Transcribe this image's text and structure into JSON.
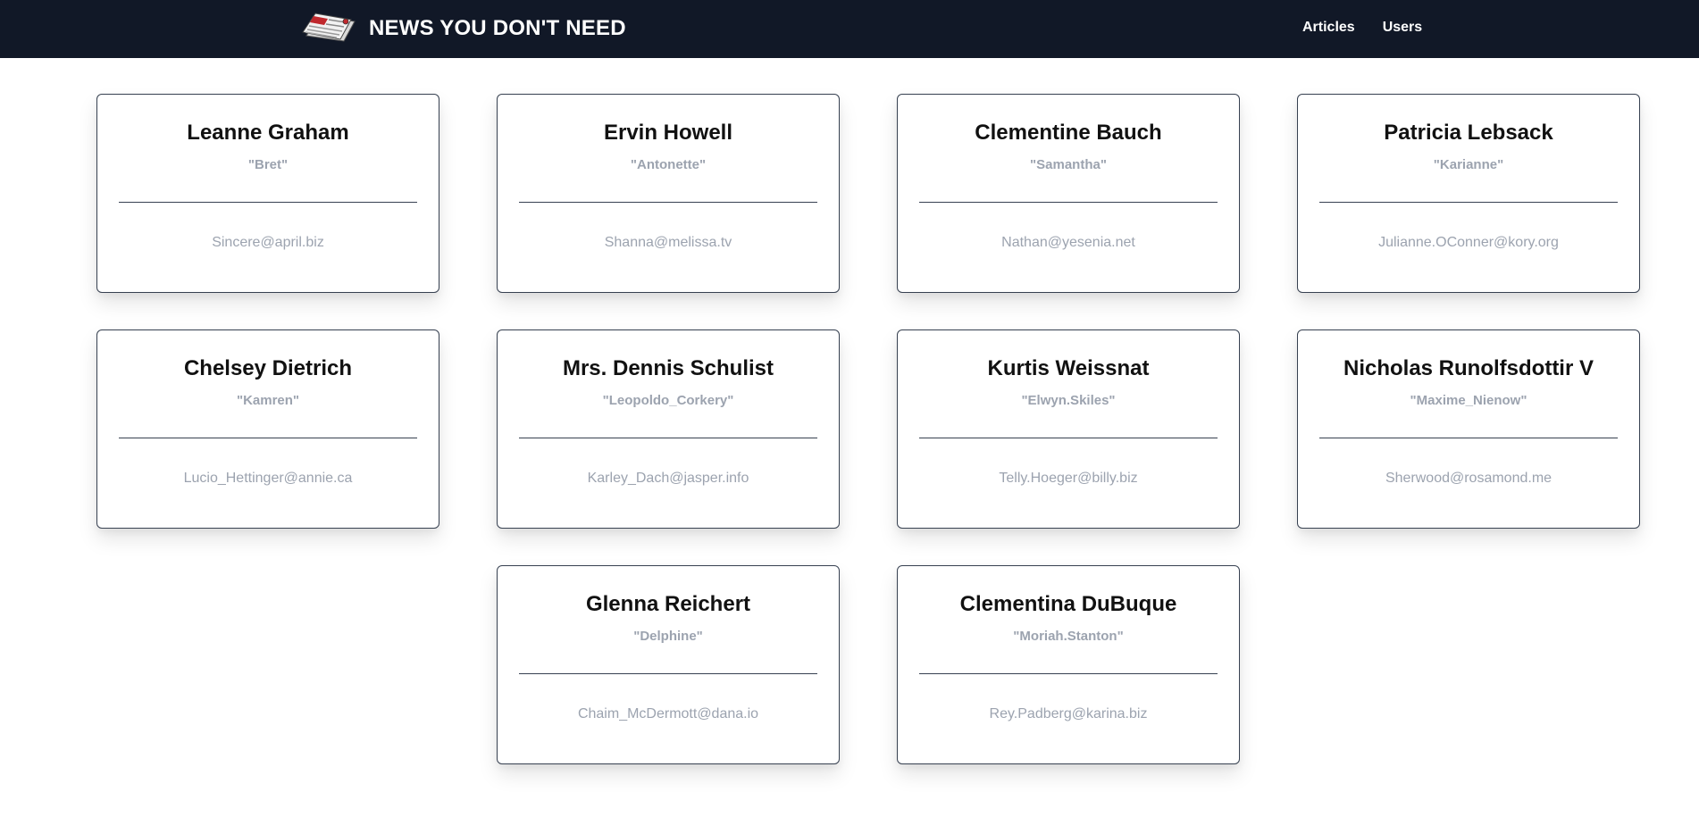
{
  "header": {
    "brand_title": "NEWS YOU DON'T NEED",
    "logo_icon": "newspaper-icon",
    "background_color": "#111827",
    "nav": [
      {
        "label": "Articles"
      },
      {
        "label": "Users"
      }
    ]
  },
  "users": [
    {
      "name": "Leanne Graham",
      "username": "\"Bret\"",
      "email": "Sincere@april.biz"
    },
    {
      "name": "Ervin Howell",
      "username": "\"Antonette\"",
      "email": "Shanna@melissa.tv"
    },
    {
      "name": "Clementine Bauch",
      "username": "\"Samantha\"",
      "email": "Nathan@yesenia.net"
    },
    {
      "name": "Patricia Lebsack",
      "username": "\"Karianne\"",
      "email": "Julianne.OConner@kory.org"
    },
    {
      "name": "Chelsey Dietrich",
      "username": "\"Kamren\"",
      "email": "Lucio_Hettinger@annie.ca"
    },
    {
      "name": "Mrs. Dennis Schulist",
      "username": "\"Leopoldo_Corkery\"",
      "email": "Karley_Dach@jasper.info"
    },
    {
      "name": "Kurtis Weissnat",
      "username": "\"Elwyn.Skiles\"",
      "email": "Telly.Hoeger@billy.biz"
    },
    {
      "name": "Nicholas Runolfsdottir V",
      "username": "\"Maxime_Nienow\"",
      "email": "Sherwood@rosamond.me"
    },
    {
      "name": "Glenna Reichert",
      "username": "\"Delphine\"",
      "email": "Chaim_McDermott@dana.io"
    },
    {
      "name": "Clementina DuBuque",
      "username": "\"Moriah.Stanton\"",
      "email": "Rey.Padberg@karina.biz"
    }
  ]
}
